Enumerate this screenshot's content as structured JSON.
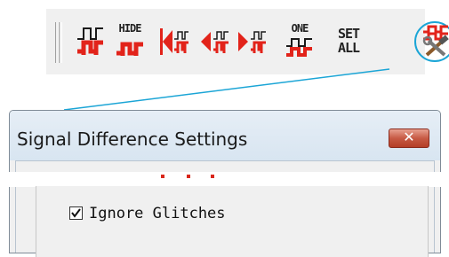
{
  "toolbar": {
    "buttons": [
      {
        "name": "signal-pulse-icon",
        "label": ""
      },
      {
        "name": "hide-signal-icon",
        "label": "HIDE"
      },
      {
        "name": "first-difference-icon",
        "label": ""
      },
      {
        "name": "previous-difference-icon",
        "label": ""
      },
      {
        "name": "next-difference-icon",
        "label": ""
      },
      {
        "name": "one-signal-icon",
        "label": "ONE"
      },
      {
        "name": "set-all-icon",
        "label": "SET ALL"
      },
      {
        "name": "settings-tools-icon",
        "label": ""
      }
    ],
    "hide_label": "HIDE",
    "one_label": "ONE",
    "set_label": "SET",
    "all_label": "ALL"
  },
  "dialog": {
    "title": "Signal Difference Settings",
    "close_symbol": "✕",
    "ignore_glitches_label": "Ignore Glitches",
    "ignore_glitches_checked": true
  },
  "colors": {
    "signal_red": "#e2231a",
    "signal_black": "#1a1a1a",
    "highlight_ring": "#1ba5d6",
    "close_button": "#c75a44"
  }
}
